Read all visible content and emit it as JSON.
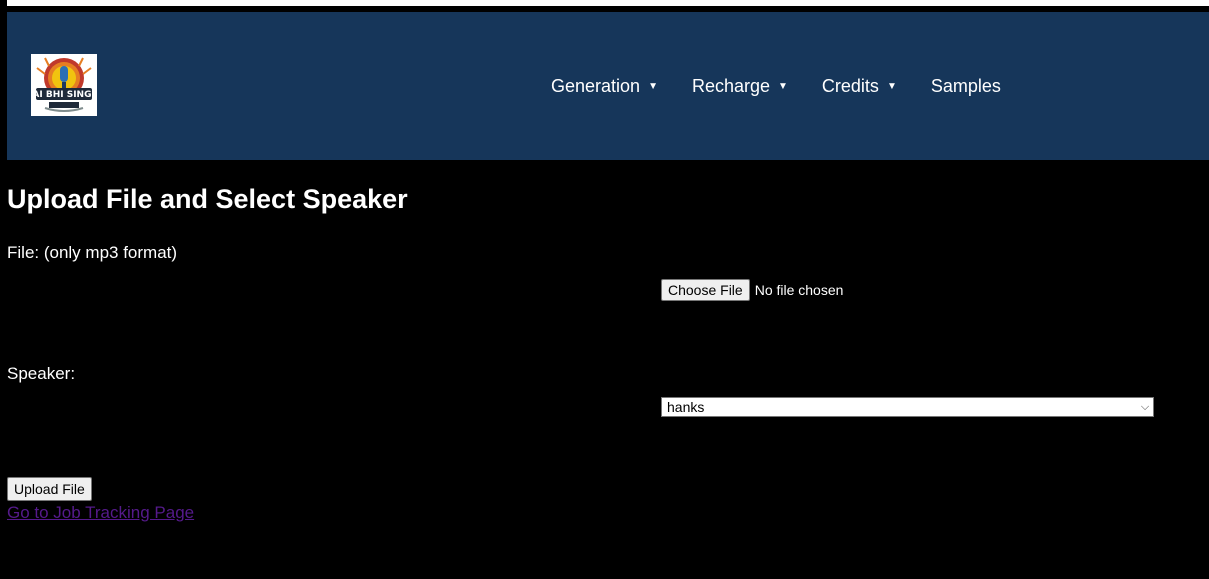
{
  "header": {
    "logo_alt": "MAI BHI SINGER",
    "background": "#16365a",
    "nav": [
      {
        "label": "Generation",
        "has_dropdown": true,
        "icon": "caret-down-icon"
      },
      {
        "label": "Recharge",
        "has_dropdown": true,
        "icon": "caret-down-icon"
      },
      {
        "label": "Credits",
        "has_dropdown": true,
        "icon": "caret-down-icon"
      },
      {
        "label": "Samples",
        "has_dropdown": false
      }
    ],
    "caret": "▼"
  },
  "main": {
    "title": "Upload File and Select Speaker",
    "file_label": "File: (only mp3 format)",
    "choose_file_label": "Choose File",
    "no_file_text": "No file chosen",
    "speaker_label": "Speaker:",
    "speaker_selected": "hanks",
    "upload_label": "Upload File",
    "job_link": "Go to Job Tracking Page"
  },
  "colors": {
    "page_bg": "#000000",
    "header_bg": "#16365a",
    "link_visited": "#551a8b"
  }
}
